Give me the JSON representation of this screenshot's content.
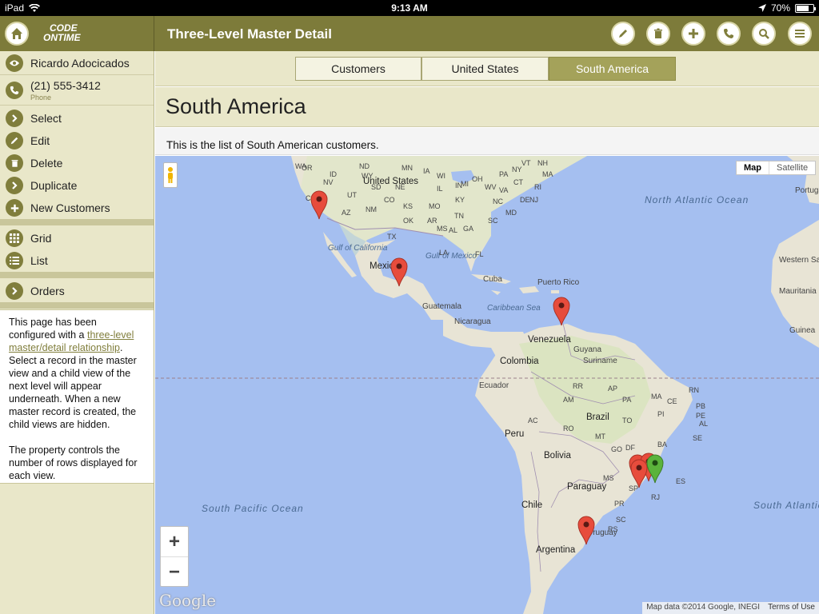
{
  "status_bar": {
    "device": "iPad",
    "time": "9:13 AM",
    "battery": "70%",
    "battery_level": 0.7
  },
  "header": {
    "logo_line1": "CODE",
    "logo_line2": "ONTIME",
    "title": "Three-Level Master Detail",
    "tools": [
      "pencil-icon",
      "trash-icon",
      "plus-icon",
      "phone-icon",
      "search-icon",
      "menu-icon"
    ]
  },
  "sidebar": {
    "record_name": "Ricardo Adocicados",
    "phone": "(21) 555-3412",
    "phone_label": "Phone",
    "actions": [
      "Select",
      "Edit",
      "Delete",
      "Duplicate",
      "New Customers"
    ],
    "views": [
      "Grid",
      "List"
    ],
    "related": [
      "Orders"
    ],
    "info_text_1": "This page has been configured with a ",
    "info_link": "three-level master/detail relationship",
    "info_text_2": ". Select a record in the master view and a child view of the next level will appear underneath. When a new master record is created, the child views are hidden.",
    "info_text_3": "The property controls the number of rows displayed for each view."
  },
  "tabs": [
    {
      "label": "Customers",
      "active": false
    },
    {
      "label": "United States",
      "active": false
    },
    {
      "label": "South America",
      "active": true
    }
  ],
  "section_title": "South America",
  "description": "This is the list of South American customers.",
  "map": {
    "type_buttons": [
      "Map",
      "Satellite"
    ],
    "zoom_in": "+",
    "zoom_out": "−",
    "google": "Google",
    "attribution": "Map data ©2014 Google, INEGI",
    "terms": "Terms of Use",
    "oceans": [
      "North Atlantic Ocean",
      "South Pacific Ocean",
      "South Atlantic Ocean"
    ],
    "seas": [
      "Gulf of California",
      "Gulf of Mexico",
      "Caribbean Sea"
    ],
    "countries": [
      "United States",
      "Mexico",
      "Cuba",
      "Puerto Rico",
      "Guatemala",
      "Nicaragua",
      "Venezuela",
      "Guyana",
      "Suriname",
      "Colombia",
      "Ecuador",
      "Peru",
      "Brazil",
      "Bolivia",
      "Paraguay",
      "Chile",
      "Argentina",
      "Uruguay",
      "Portugal",
      "Western Sahara",
      "Mauritania",
      "Guinea"
    ],
    "states": [
      "WA",
      "ND",
      "MN",
      "WI",
      "MI",
      "NY",
      "VT",
      "NH",
      "MA",
      "CT",
      "RI",
      "NJ",
      "PA",
      "OH",
      "IN",
      "IL",
      "IA",
      "NE",
      "SD",
      "WY",
      "ID",
      "OR",
      "NV",
      "CA",
      "UT",
      "CO",
      "KS",
      "MO",
      "KY",
      "WV",
      "VA",
      "MD",
      "DE",
      "TN",
      "NC",
      "SC",
      "GA",
      "AL",
      "MS",
      "AR",
      "OK",
      "TX",
      "LA",
      "FL",
      "NM",
      "AZ"
    ],
    "br_states": [
      "RR",
      "AP",
      "AM",
      "PA",
      "MA",
      "CE",
      "RN",
      "PB",
      "PE",
      "AL",
      "SE",
      "PI",
      "TO",
      "BA",
      "AC",
      "RO",
      "MT",
      "GO",
      "DF",
      "MG",
      "ES",
      "RJ",
      "SP",
      "MS",
      "PR",
      "SC",
      "RS"
    ],
    "marker_colors": {
      "red": "#e74c3c",
      "green": "#5bb33b"
    }
  }
}
